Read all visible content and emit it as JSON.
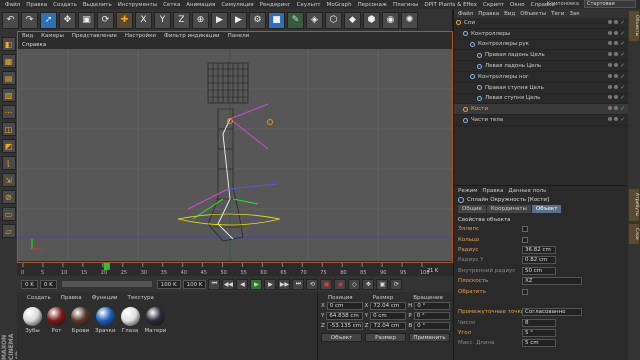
{
  "menubar": {
    "items": [
      "Файл",
      "Правка",
      "Создать",
      "Выделить",
      "Инструменты",
      "Сетка",
      "Анимация",
      "Симуляция",
      "Рендеринг",
      "Скульпт",
      "MoGraph",
      "Персонаж",
      "Плагины",
      "DPIT Plants & Effex",
      "Скрипт",
      "Окно",
      "Справка"
    ],
    "layout_label": "Компоновка",
    "layout_value": "Стартовая"
  },
  "viewport": {
    "menu": [
      "Вид",
      "Камеры",
      "Представление",
      "Настройки",
      "Фильтр индикации",
      "Панели"
    ],
    "name": "Справка"
  },
  "timeline": {
    "ticks": [
      "0",
      "5",
      "10",
      "15",
      "20",
      "25",
      "30",
      "35",
      "40",
      "45",
      "50",
      "55",
      "60",
      "65",
      "70",
      "75",
      "80",
      "85",
      "90",
      "95",
      "100"
    ],
    "end_label": "21 K",
    "current_frame": 21,
    "max_frame": 100
  },
  "playbar": {
    "start": "0 K",
    "min": "0 K",
    "max": "100 K",
    "end": "100 K"
  },
  "materials": {
    "menu": [
      "Создать",
      "Правка",
      "Функции",
      "Текстура"
    ],
    "items": [
      {
        "label": "Зубы",
        "color": "#d9d9d9"
      },
      {
        "label": "Рот",
        "color": "#7a1a1a"
      },
      {
        "label": "Брови",
        "color": "#5a3a2a"
      },
      {
        "label": "Зрачки",
        "color": "#1d5fb8"
      },
      {
        "label": "Глаза",
        "color": "#e0e0e0"
      },
      {
        "label": "Матери",
        "color": "#2a2a3a"
      }
    ]
  },
  "coords": {
    "headers": [
      "Позиция",
      "Размер",
      "Вращение"
    ],
    "rows": [
      {
        "axis": "X",
        "pos": "0 cm",
        "size": "72.04 cm",
        "rot_axis": "H",
        "rot": "0 °"
      },
      {
        "axis": "Y",
        "pos": "64.838 cm",
        "size": "0 cm",
        "rot_axis": "P",
        "rot": "0 °"
      },
      {
        "axis": "Z",
        "pos": "-53.135 cm",
        "size": "72.04 cm",
        "rot_axis": "B",
        "rot": "0 °"
      }
    ],
    "mode1": "Объект",
    "mode2": "Размер",
    "apply": "Применить"
  },
  "object_manager": {
    "menu": [
      "Файл",
      "Правка",
      "Вид",
      "Объекты",
      "Теги",
      "Зак"
    ],
    "rows": [
      {
        "label": "Спи",
        "indent": 0,
        "color": "#e8a050"
      },
      {
        "label": "Контроллеры",
        "indent": 1,
        "color": "#8ab4e8"
      },
      {
        "label": "Контроллеры рук",
        "indent": 2,
        "color": "#8ab4e8"
      },
      {
        "label": "Правая ладонь Цель",
        "indent": 3,
        "color": "#8ab4e8"
      },
      {
        "label": "Левая ладонь Цель",
        "indent": 3,
        "color": "#8ab4e8"
      },
      {
        "label": "Контроллеры ног",
        "indent": 2,
        "color": "#8ab4e8"
      },
      {
        "label": "Правая ступня Цель",
        "indent": 3,
        "color": "#8ab4e8"
      },
      {
        "label": "Левая ступня Цель",
        "indent": 3,
        "color": "#8ab4e8"
      },
      {
        "label": "Кости",
        "indent": 1,
        "color": "#e8a050"
      },
      {
        "label": "Части тела",
        "indent": 1,
        "color": "#8ab4e8"
      }
    ]
  },
  "attributes": {
    "menu": [
      "Режим",
      "Правка",
      "Данные поль"
    ],
    "object_title": "Сплайн Окружность [Кости]",
    "tabs": [
      "Общие",
      "Координаты",
      "Объект"
    ],
    "section": "Свойства объекта",
    "props": [
      {
        "label": "Эллипс",
        "value": "",
        "type": "check",
        "dim": false
      },
      {
        "label": "Кольцо",
        "value": "",
        "type": "check",
        "dim": false
      },
      {
        "label": "Радиус",
        "value": "36.82 cm",
        "type": "val",
        "dim": false
      },
      {
        "label": "Радиус Y",
        "value": "0.82 cm",
        "type": "val",
        "dim": true
      },
      {
        "label": "Внутренний радиус",
        "value": "50 cm",
        "type": "val",
        "dim": true
      },
      {
        "label": "Плоскость",
        "value": "XZ",
        "type": "wide",
        "dim": false
      },
      {
        "label": "Обратить",
        "value": "",
        "type": "check",
        "dim": false
      },
      {
        "label": "",
        "value": "",
        "type": "blank",
        "dim": false
      },
      {
        "label": "Промежуточные точки",
        "value": "Согласованно",
        "type": "wide",
        "dim": false
      },
      {
        "label": "Число",
        "value": "8",
        "type": "val",
        "dim": true
      },
      {
        "label": "Угол",
        "value": "5 °",
        "type": "val",
        "dim": false
      },
      {
        "label": "Макс. Длина",
        "value": "5 cm",
        "type": "val",
        "dim": true
      }
    ]
  },
  "right_tabs": [
    "Объекты",
    "Атрибуты",
    "Слои"
  ],
  "branding": "MAXON CINEMA 4D"
}
